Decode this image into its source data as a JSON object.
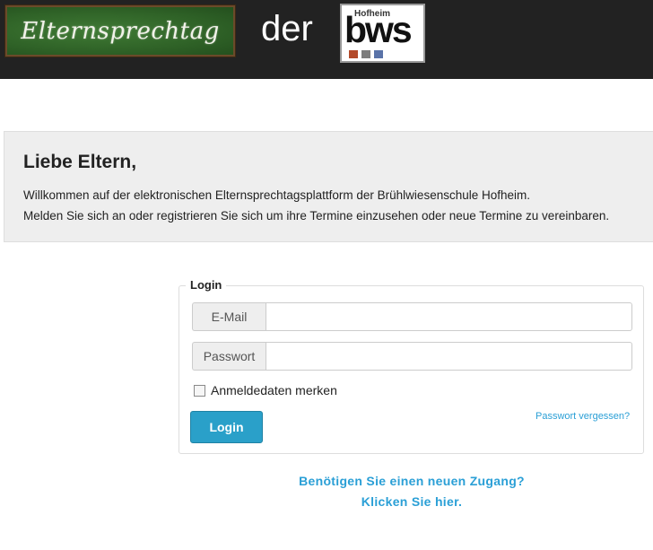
{
  "header": {
    "title_chalk": "Elternsprechtag",
    "connector": "der",
    "logo": {
      "top_text": "Hofheim",
      "main_text": "bws",
      "colors": [
        "#b34a2a",
        "#7d7d7d",
        "#5a73a8"
      ]
    }
  },
  "intro": {
    "heading": "Liebe Eltern,",
    "line1": "Willkommen auf der elektronischen Elternsprechtagsplattform der Brühlwiesenschule Hofheim.",
    "line2": "Melden Sie sich an oder registrieren Sie sich um ihre Termine einzusehen oder neue Termine zu vereinbaren."
  },
  "login": {
    "legend": "Login",
    "email_label": "E-Mail",
    "email_value": "",
    "password_label": "Passwort",
    "password_value": "",
    "remember_label": "Anmeldedaten merken",
    "remember_checked": false,
    "submit_label": "Login",
    "forgot_label": "Passwort vergessen?"
  },
  "register": {
    "question": "Benötigen Sie einen neuen Zugang?",
    "link": "Klicken Sie hier."
  },
  "colors": {
    "navbar": "#222222",
    "primary": "#2aa0c9",
    "link": "#2a9fd6"
  }
}
